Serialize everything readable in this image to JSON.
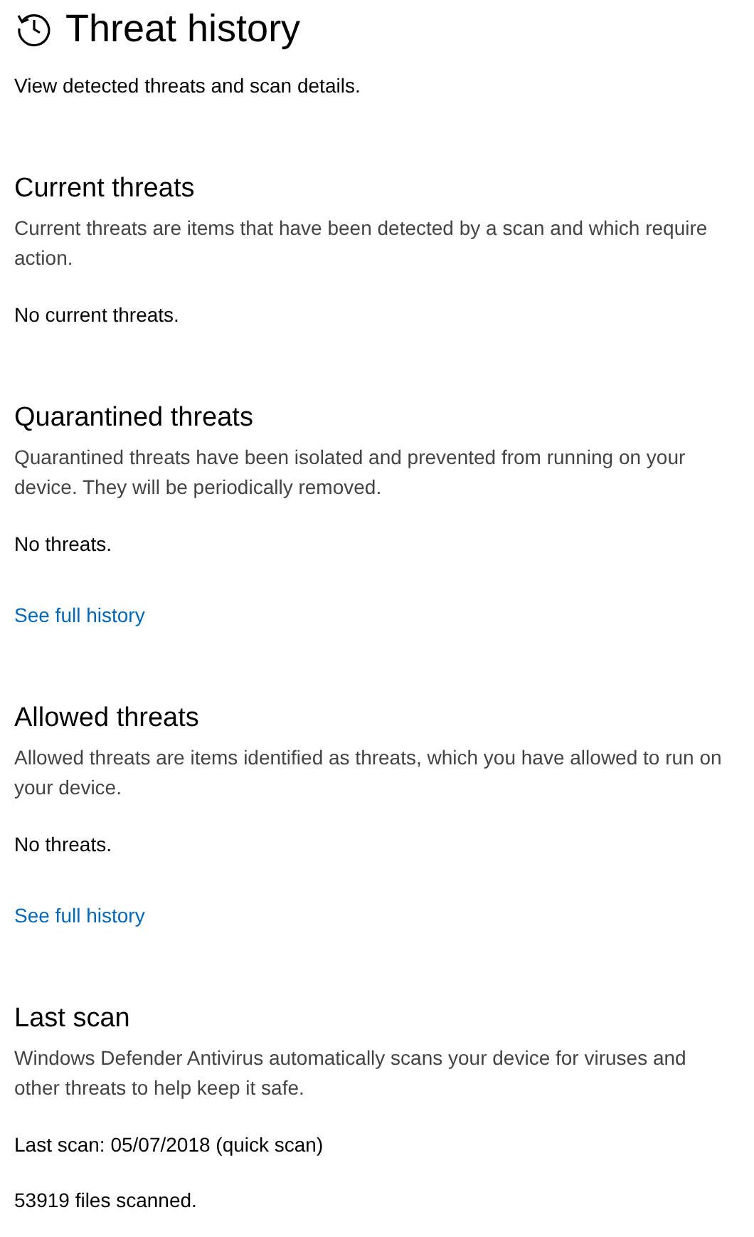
{
  "page": {
    "title": "Threat history",
    "subtitle": "View detected threats and scan details."
  },
  "sections": [
    {
      "heading": "Current threats",
      "description": "Current threats are items that have been detected by a scan and which require action.",
      "items": [
        {
          "kind": "status",
          "text": "No current threats."
        }
      ]
    },
    {
      "heading": "Quarantined threats",
      "description": "Quarantined threats have been isolated and prevented from running on your device. They will be periodically removed.",
      "items": [
        {
          "kind": "status",
          "text": "No threats."
        },
        {
          "kind": "link",
          "text": "See full history"
        }
      ]
    },
    {
      "heading": "Allowed threats",
      "description": "Allowed threats are items identified as threats, which you have allowed to run on your device.",
      "items": [
        {
          "kind": "status",
          "text": "No threats."
        },
        {
          "kind": "link",
          "text": "See full history"
        }
      ]
    },
    {
      "heading": "Last scan",
      "description": "Windows Defender Antivirus automatically scans your device for viruses and other threats to help keep it safe.",
      "items": [
        {
          "kind": "status",
          "text": "Last scan: 05/07/2018 (quick scan)"
        },
        {
          "kind": "status",
          "text": "53919 files scanned."
        }
      ]
    }
  ]
}
